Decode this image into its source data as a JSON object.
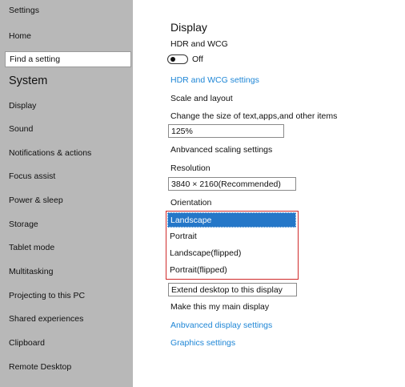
{
  "sidebar": {
    "header": "Settings",
    "home": "Home",
    "search_value": "Find a setting",
    "section": "System",
    "items": [
      {
        "label": "Display"
      },
      {
        "label": "Sound"
      },
      {
        "label": "Notifications & actions"
      },
      {
        "label": "Focus assist"
      },
      {
        "label": "Power & sleep"
      },
      {
        "label": "Storage"
      },
      {
        "label": "Tablet mode"
      },
      {
        "label": "Multitasking"
      },
      {
        "label": "Projecting to this PC"
      },
      {
        "label": "Shared experiences"
      },
      {
        "label": "Clipboard"
      },
      {
        "label": "Remote Desktop"
      }
    ]
  },
  "main": {
    "title": "Display",
    "hdr": {
      "heading": "HDR and WCG",
      "toggle_state": "Off",
      "settings_link": "HDR and WCG settings"
    },
    "scale": {
      "heading": "Scale and layout",
      "size_label": "Change the size of text,apps,and other items",
      "size_value": "125%",
      "advanced_scaling": "Anbvanced scaling settings"
    },
    "resolution": {
      "label": "Resolution",
      "value": "3840 × 2160(Recommended)"
    },
    "orientation": {
      "label": "Orientation",
      "options": [
        {
          "label": "Landscape",
          "selected": true
        },
        {
          "label": "Portrait",
          "selected": false
        },
        {
          "label": "Landscape(flipped)",
          "selected": false
        },
        {
          "label": "Portrait(flipped)",
          "selected": false
        }
      ]
    },
    "multiple_displays": {
      "value": "Extend desktop to this display",
      "main_display": "Make this my main display",
      "advanced_link": "Anbvanced display settings",
      "graphics_link": "Graphics settings"
    }
  },
  "colors": {
    "sidebar_bg": "#b8b8b8",
    "link": "#1e86d6",
    "selection": "#2577c8",
    "highlight_border": "#d02a2a"
  }
}
